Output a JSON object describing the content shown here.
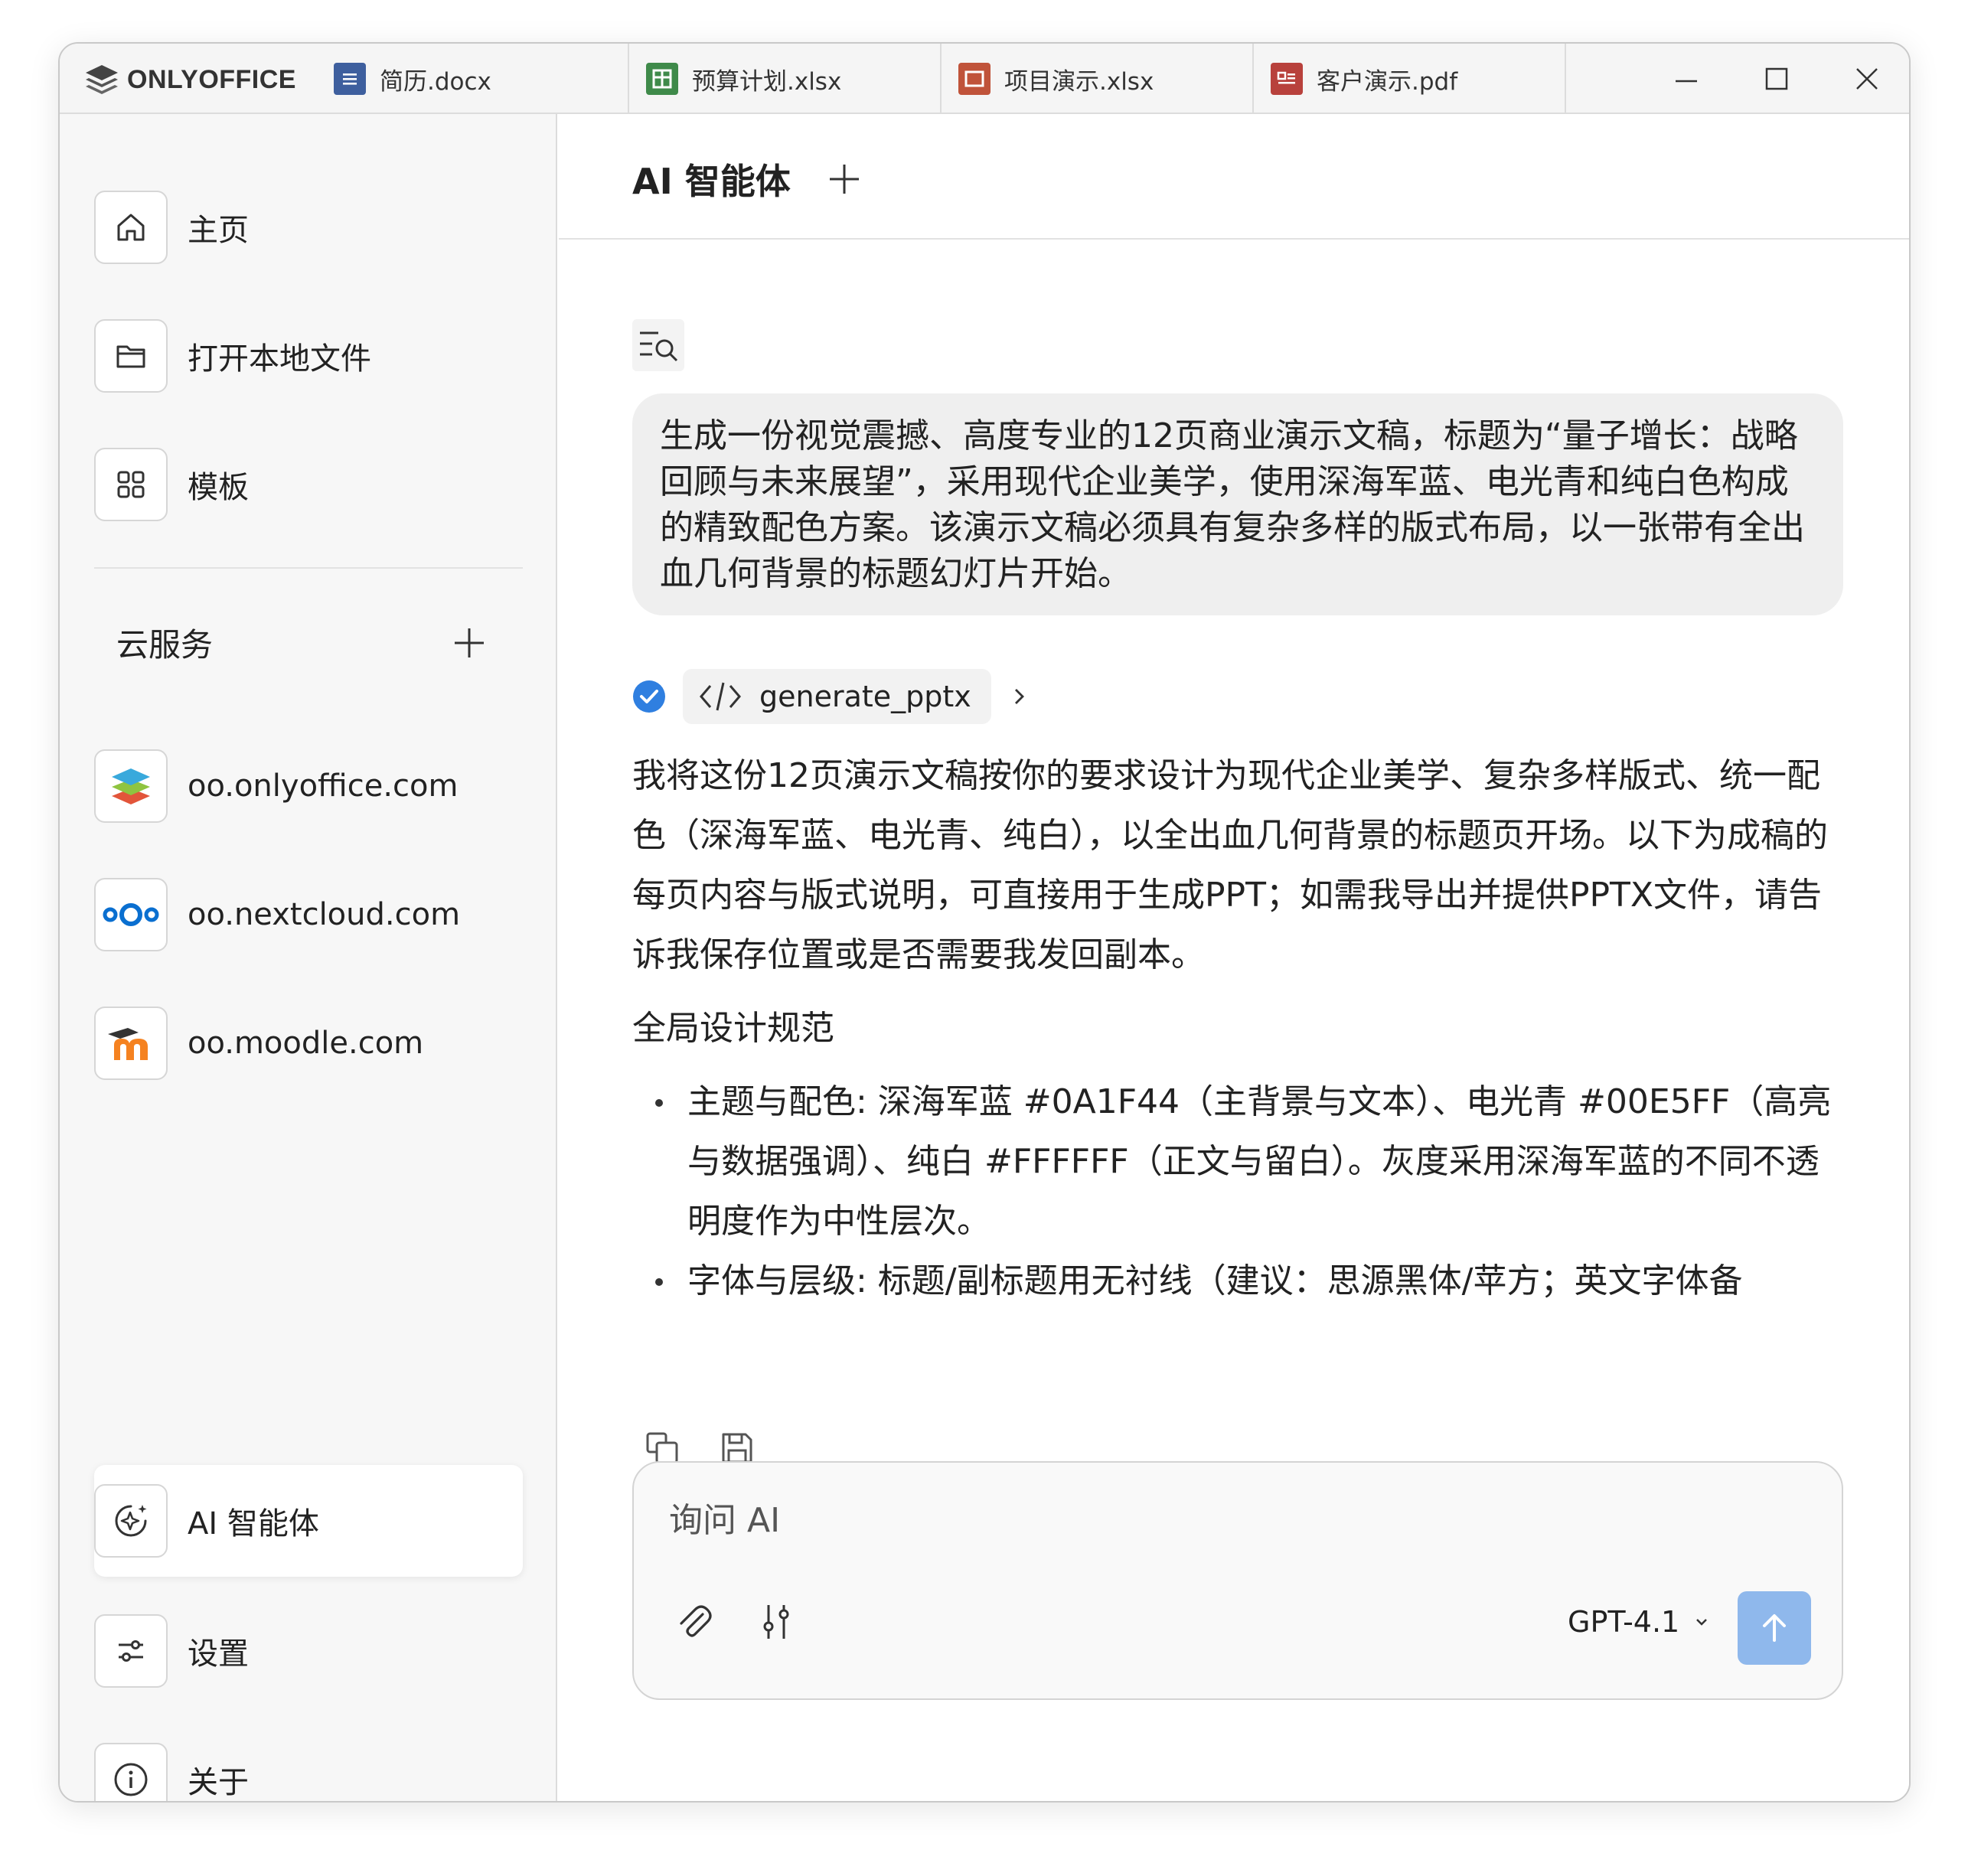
{
  "app": {
    "logo_text": "ONLYOFFICE"
  },
  "tabs": [
    {
      "label": "简历.docx",
      "icon": "document-icon",
      "color": "#3e5f9e"
    },
    {
      "label": "预算计划.xlsx",
      "icon": "spreadsheet-icon",
      "color": "#3f8a4a"
    },
    {
      "label": "项目演示.xlsx",
      "icon": "presentation-icon",
      "color": "#c0533a"
    },
    {
      "label": "客户演示.pdf",
      "icon": "pdf-icon",
      "color": "#b8413c"
    }
  ],
  "sidebar": {
    "items": [
      {
        "label": "主页",
        "icon": "home-icon"
      },
      {
        "label": "打开本地文件",
        "icon": "folder-icon"
      },
      {
        "label": "模板",
        "icon": "templates-grid-icon"
      }
    ],
    "cloud_header": "云服务",
    "cloud_items": [
      {
        "label": "oo.onlyoffice.com",
        "icon": "onlyoffice-logo-icon"
      },
      {
        "label": "oo.nextcloud.com",
        "icon": "nextcloud-logo-icon"
      },
      {
        "label": "oo.moodle.com",
        "icon": "moodle-logo-icon"
      }
    ],
    "bottom_items": [
      {
        "label": "AI 智能体",
        "icon": "ai-sparkle-icon",
        "active": true
      },
      {
        "label": "设置",
        "icon": "settings-sliders-icon"
      },
      {
        "label": "关于",
        "icon": "info-icon"
      }
    ]
  },
  "main": {
    "title": "AI 智能体",
    "user_message": "生成一份视觉震撼、高度专业的12页商业演示文稿，标题为“量子增长：战略回顾与未来展望”，采用现代企业美学，使用深海军蓝、电光青和纯白色构成的精致配色方案。该演示文稿必须具有复杂多样的版式布局，以一张带有全出血几何背景的标题幻灯片开始。",
    "tool_call": {
      "name": "generate_pptx",
      "status_color": "#2f7fe0"
    },
    "response": {
      "intro": "我将这份12页演示文稿按你的要求设计为现代企业美学、复杂多样版式、统一配色（深海军蓝、电光青、纯白），以全出血几何背景的标题页开场。以下为成稿的每页内容与版式说明，可直接用于生成PPT；如需我导出并提供PPTX文件，请告诉我保存位置或是否需要我发回副本。",
      "section_title": "全局设计规范",
      "bullets": [
        "主题与配色: 深海军蓝 #0A1F44（主背景与文本）、电光青 #00E5FF（高亮与数据强调）、纯白 #FFFFFF（正文与留白）。灰度采用深海军蓝的不同不透明度作为中性层次。",
        "字体与层级: 标题/副标题用无衬线（建议：思源黑体/苹方；英文字体备"
      ]
    },
    "composer": {
      "placeholder": "询问 AI",
      "model": "GPT-4.1",
      "send_color": "#8fb8ec"
    }
  }
}
